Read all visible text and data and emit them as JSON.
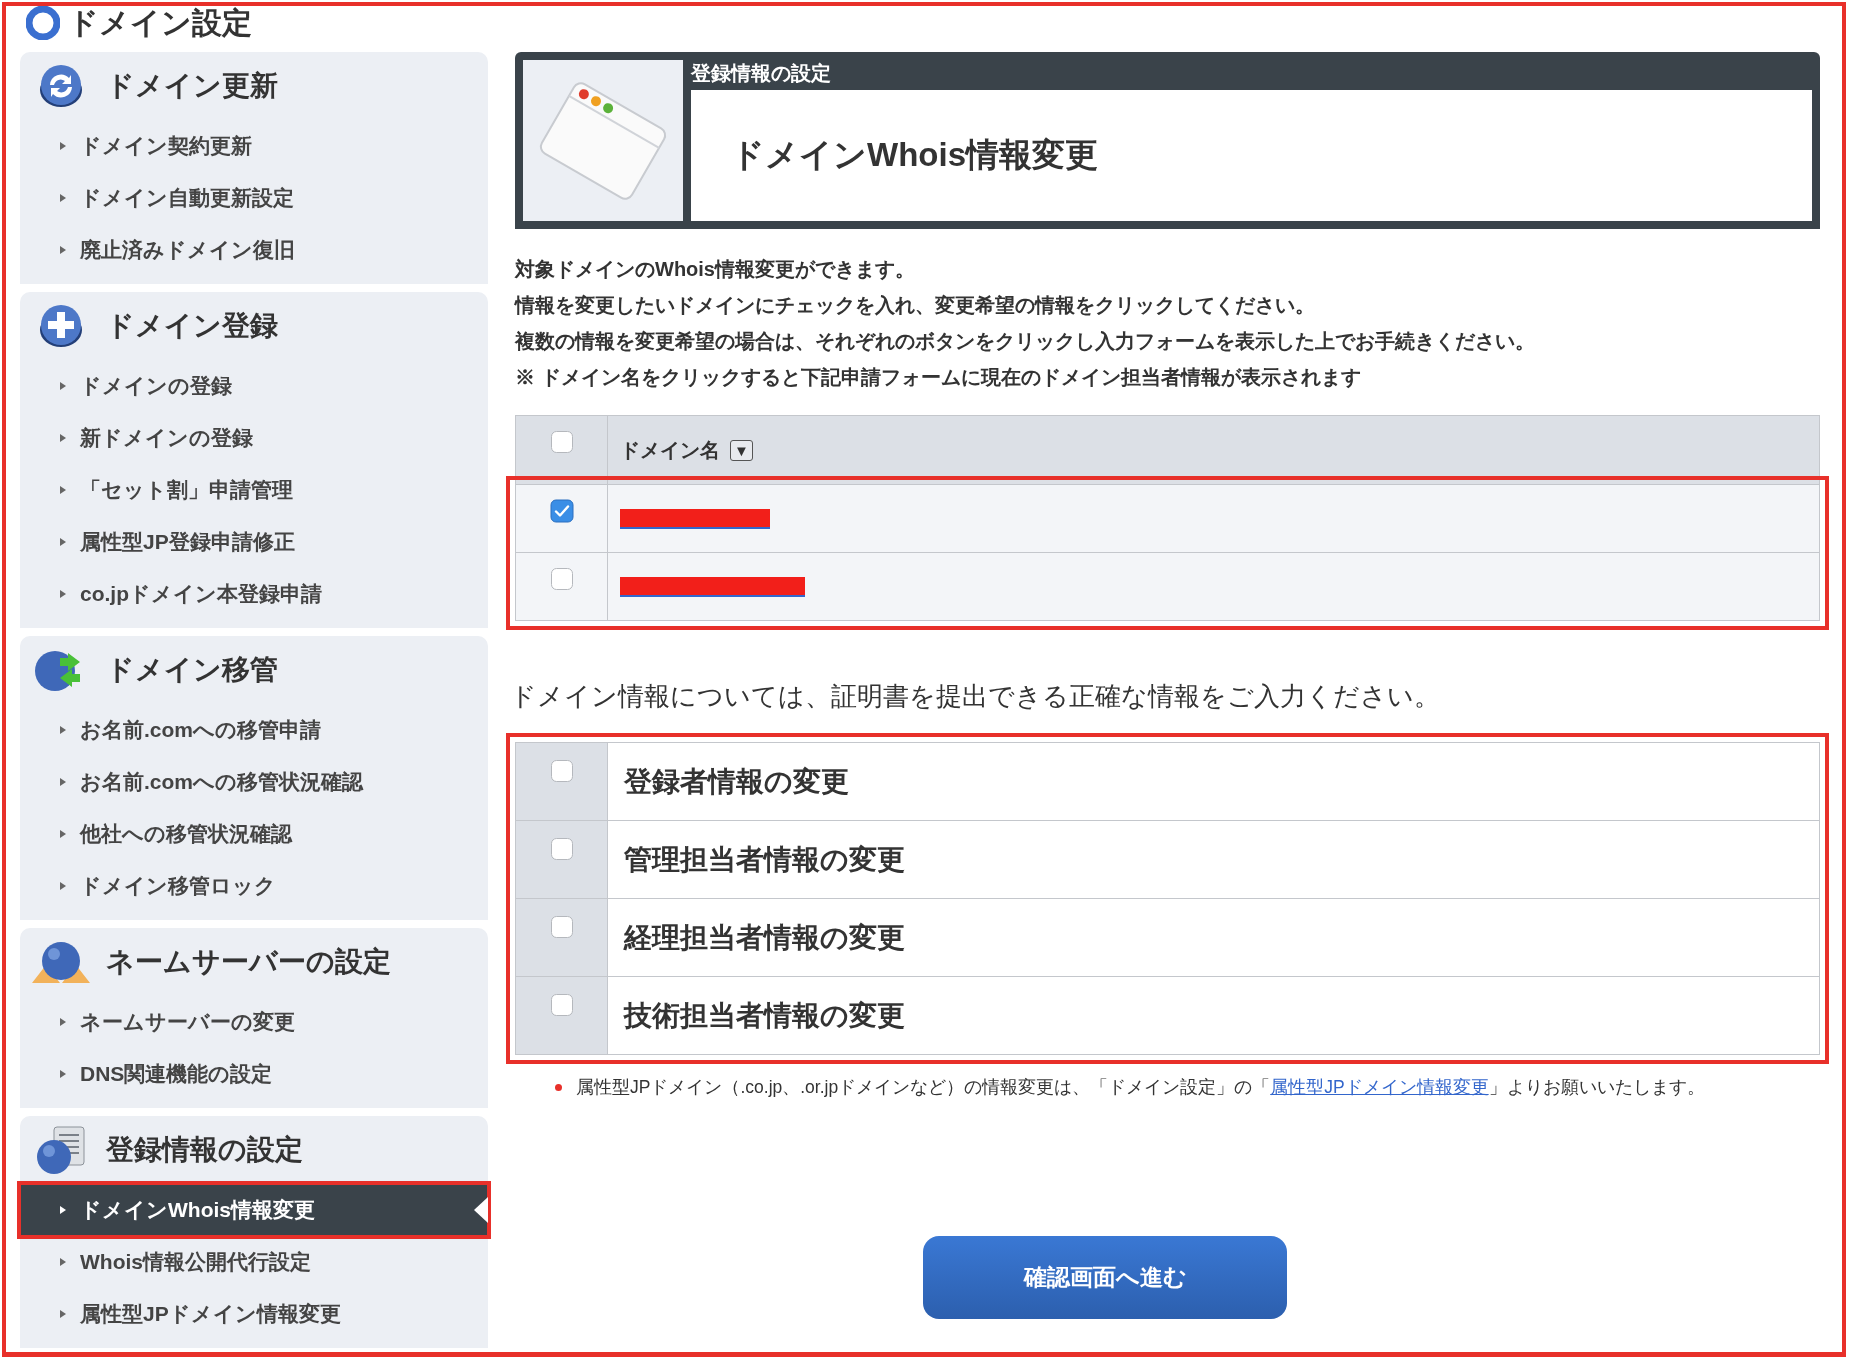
{
  "page_title": "ドメイン設定",
  "page_highlight": true,
  "sidebar": {
    "groups": [
      {
        "title": "ドメイン更新",
        "items": [
          {
            "label": "ドメイン契約更新",
            "selected": false
          },
          {
            "label": "ドメイン自動更新設定",
            "selected": false
          },
          {
            "label": "廃止済みドメイン復旧",
            "selected": false
          }
        ]
      },
      {
        "title": "ドメイン登録",
        "items": [
          {
            "label": "ドメインの登録",
            "selected": false
          },
          {
            "label": "新ドメインの登録",
            "selected": false
          },
          {
            "label": "「セット割」申請管理",
            "selected": false
          },
          {
            "label": "属性型JP登録申請修正",
            "selected": false
          },
          {
            "label": "co.jpドメイン本登録申請",
            "selected": false
          }
        ]
      },
      {
        "title": "ドメイン移管",
        "items": [
          {
            "label": "お名前.comへの移管申請",
            "selected": false
          },
          {
            "label": "お名前.comへの移管状況確認",
            "selected": false
          },
          {
            "label": "他社への移管状況確認",
            "selected": false
          },
          {
            "label": "ドメイン移管ロック",
            "selected": false
          }
        ]
      },
      {
        "title": "ネームサーバーの設定",
        "items": [
          {
            "label": "ネームサーバーの変更",
            "selected": false
          },
          {
            "label": "DNS関連機能の設定",
            "selected": false
          }
        ]
      },
      {
        "title": "登録情報の設定",
        "items": [
          {
            "label": "ドメインWhois情報変更",
            "selected": true,
            "highlight": true
          },
          {
            "label": "Whois情報公開代行設定",
            "selected": false
          },
          {
            "label": "属性型JPドメイン情報変更",
            "selected": false
          }
        ]
      }
    ]
  },
  "header_card": {
    "category": "登録情報の設定",
    "title": "ドメインWhois情報変更"
  },
  "description": [
    "対象ドメインのWhois情報変更ができます。",
    "情報を変更したいドメインにチェックを入れ、変更希望の情報をクリックしてください。",
    "複数の情報を変更希望の場合は、それぞれのボタンをクリックし入力フォームを表示した上でお手続きください。",
    "※ ドメイン名をクリックすると下記申請フォームに現在のドメイン担当者情報が表示されます"
  ],
  "domain_table": {
    "select_all_checked": false,
    "column": "ドメイン名",
    "sort_icon": "▼",
    "highlight": true,
    "rows": [
      {
        "checked": true,
        "redacted": true
      },
      {
        "checked": false,
        "redacted": true
      }
    ]
  },
  "notice": "ドメイン情報については、証明書を提出できる正確な情報をご入力ください。",
  "change_options": {
    "highlight": true,
    "items": [
      {
        "label": "登録者情報の変更",
        "checked": false
      },
      {
        "label": "管理担当者情報の変更",
        "checked": false
      },
      {
        "label": "経理担当者情報の変更",
        "checked": false
      },
      {
        "label": "技術担当者情報の変更",
        "checked": false
      }
    ]
  },
  "note": {
    "text_before": "属性型JPドメイン（.co.jp、.or.jpドメインなど）の情報変更は、「ドメイン設定」の「",
    "link": "属性型JPドメイン情報変更",
    "text_after": "」よりお願いいたします。"
  },
  "submit_button": "確認画面へ進む"
}
